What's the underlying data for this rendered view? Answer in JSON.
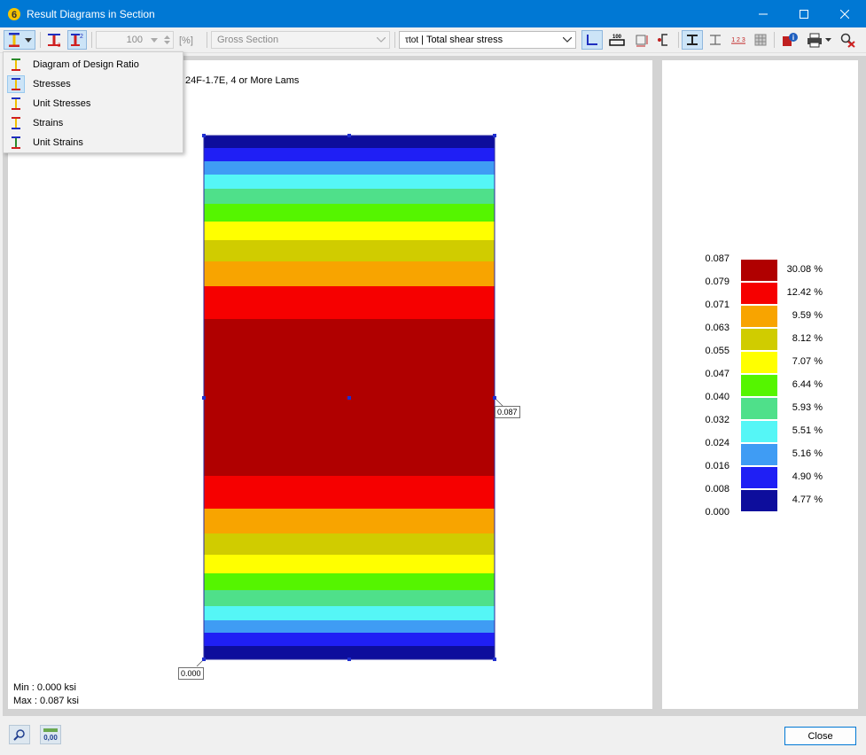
{
  "window": {
    "title": "Result Diagrams in Section"
  },
  "toolbar": {
    "zoom_value": "100",
    "zoom_unit": "[%]",
    "section_type": "Gross Section",
    "stress_symbol": "τtot",
    "stress_label": "Total shear stress"
  },
  "dropdown_menu": {
    "items": [
      {
        "label": "Diagram of Design Ratio"
      },
      {
        "label": "Stresses"
      },
      {
        "label": "Unit Stresses"
      },
      {
        "label": "Strains"
      },
      {
        "label": "Unit Strains"
      }
    ],
    "selected_index": 1
  },
  "diagram": {
    "section_name": "24F-1.7E, 4 or More Lams",
    "max_value_label": "0.087",
    "min_value_label": "0.000",
    "min_text": "Min : 0.000 ksi",
    "max_text": "Max : 0.087 ksi"
  },
  "legend": {
    "values": [
      "0.087",
      "0.079",
      "0.071",
      "0.063",
      "0.055",
      "0.047",
      "0.040",
      "0.032",
      "0.024",
      "0.016",
      "0.008",
      "0.000"
    ],
    "bands": [
      {
        "color": "#b00000",
        "percent": "30.08 %"
      },
      {
        "color": "#f60000",
        "percent": "12.42 %"
      },
      {
        "color": "#f8a400",
        "percent": "9.59 %"
      },
      {
        "color": "#d0cc00",
        "percent": "8.12 %"
      },
      {
        "color": "#ffff00",
        "percent": "7.07 %"
      },
      {
        "color": "#55f500",
        "percent": "6.44 %"
      },
      {
        "color": "#4fe08a",
        "percent": "5.93 %"
      },
      {
        "color": "#55f6f6",
        "percent": "5.51 %"
      },
      {
        "color": "#3f9cf4",
        "percent": "5.16 %"
      },
      {
        "color": "#1f1ff5",
        "percent": "4.90 %"
      },
      {
        "color": "#0d0d9c",
        "percent": "4.77 %"
      }
    ]
  },
  "footer": {
    "close_label": "Close",
    "decimals_label": "0,00"
  }
}
